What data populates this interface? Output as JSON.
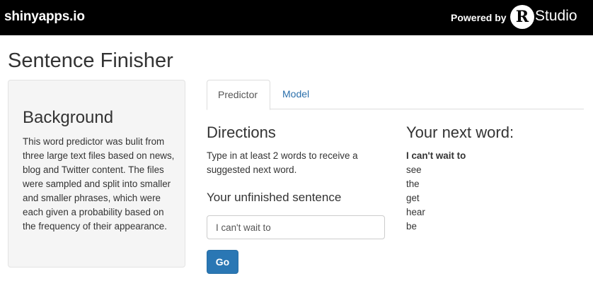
{
  "navbar": {
    "brand": "shinyapps.io",
    "powered_by": "Powered by",
    "r_letter": "R",
    "rstudio": "Studio"
  },
  "page": {
    "title": "Sentence Finisher"
  },
  "sidebar": {
    "heading": "Background",
    "text": "This word predictor was bulit from three large text files based on news, blog and Twitter content. The files were sampled and split into smaller and smaller phrases, which were each given a probability based on the frequency of their appearance."
  },
  "tabs": [
    {
      "label": "Predictor",
      "active": true
    },
    {
      "label": "Model",
      "active": false
    }
  ],
  "directions": {
    "heading": "Directions",
    "text": "Type in at least 2 words to receive a suggested next word.",
    "input_label": "Your unfinished sentence",
    "input_value": "I can't wait to",
    "button_label": "Go"
  },
  "results": {
    "heading": "Your next word:",
    "prefix": "I can't wait to",
    "words": [
      "see",
      "the",
      "get",
      "hear",
      "be"
    ]
  },
  "colors": {
    "navbar_bg": "#000000",
    "link": "#2a6fab",
    "button_bg": "#2a77b4",
    "well_bg": "#f5f5f5"
  }
}
